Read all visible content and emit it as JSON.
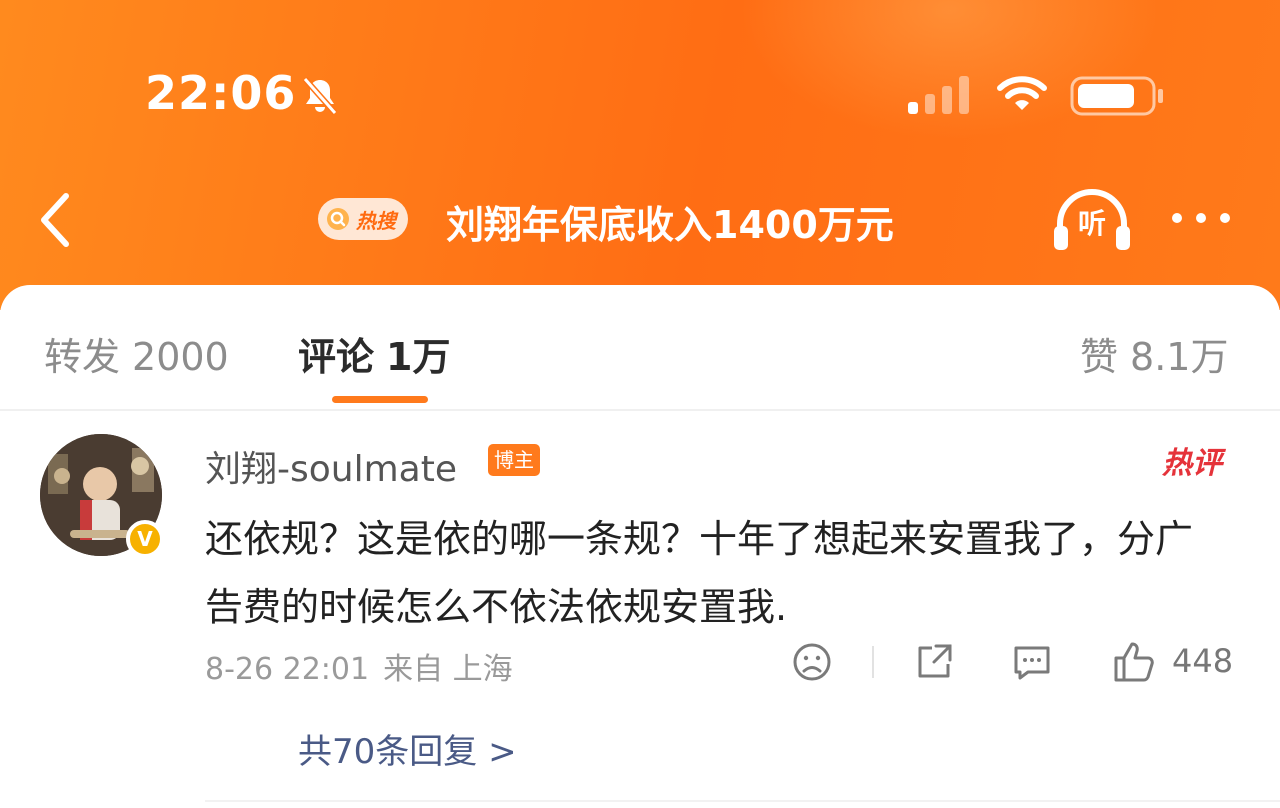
{
  "status_bar": {
    "time": "22:06"
  },
  "nav": {
    "hot_search_label": "热搜",
    "title": "刘翔年保底收入1400万元",
    "listen_label": "听"
  },
  "tabs": [
    {
      "label": "转发",
      "count": "2000"
    },
    {
      "label": "评论",
      "count": "1万"
    },
    {
      "label": "赞",
      "count": "8.1万"
    }
  ],
  "comment": {
    "username": "刘翔-soulmate",
    "role_badge": "博主",
    "hot_tag": "热评",
    "text": "还依规？这是依的哪一条规？十年了想起来安置我了，分广告费的时候怎么不依法依规安置我.",
    "date": "8-26 22:01",
    "location": "来自 上海",
    "likes": "448",
    "replies_link": "共70条回复 >"
  },
  "colors": {
    "accent": "#ff7a1c",
    "hot": "#e5333a",
    "link": "#4a5a86",
    "verified": "#f7b100"
  }
}
